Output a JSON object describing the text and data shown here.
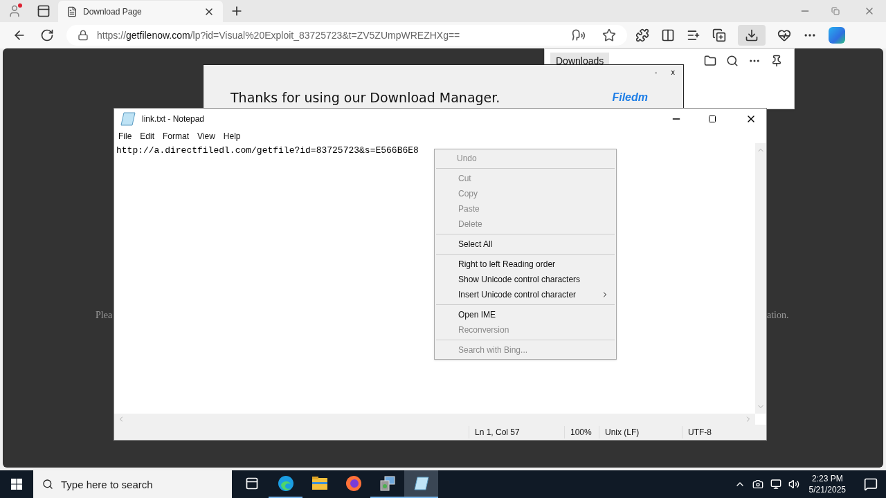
{
  "browser": {
    "tabs": [
      {
        "title": "Download Page",
        "selected": true
      }
    ],
    "address": {
      "scheme": "https://",
      "host": "getfilenow.com",
      "path": "/lp?id=Visual%20Exploit_83725723&t=ZV5ZUmpWREZHXg=="
    },
    "downloads_panel": {
      "title": "Downloads"
    },
    "page": {
      "text_left": "Plea",
      "text_right": "ation."
    },
    "dialog": {
      "minimize": "-",
      "close": "x",
      "message": "Thanks for using our Download Manager.",
      "logo": "Filedm"
    }
  },
  "notepad": {
    "title": "link.txt - Notepad",
    "menu": [
      "File",
      "Edit",
      "Format",
      "View",
      "Help"
    ],
    "content": "http://a.directfiledl.com/getfile?id=83725723&s=E566B6E8",
    "status_bar": [
      "Ln 1, Col 57",
      "100%",
      "Unix (LF)",
      "UTF-8"
    ]
  },
  "context_menu": {
    "groups": [
      [
        {
          "label": "Undo",
          "disabled": true,
          "submenu": false
        }
      ],
      [
        {
          "label": "Cut",
          "disabled": true,
          "submenu": false
        },
        {
          "label": "Copy",
          "disabled": true,
          "submenu": false
        },
        {
          "label": "Paste",
          "disabled": true,
          "submenu": false
        },
        {
          "label": "Delete",
          "disabled": true,
          "submenu": false
        }
      ],
      [
        {
          "label": "Select All",
          "disabled": false,
          "submenu": false
        }
      ],
      [
        {
          "label": "Right to left Reading order",
          "disabled": false,
          "submenu": false
        },
        {
          "label": "Show Unicode control characters",
          "disabled": false,
          "submenu": false
        },
        {
          "label": "Insert Unicode control character",
          "disabled": false,
          "submenu": true
        }
      ],
      [
        {
          "label": "Open IME",
          "disabled": false,
          "submenu": false
        },
        {
          "label": "Reconversion",
          "disabled": true,
          "submenu": false
        }
      ],
      [
        {
          "label": "Search with Bing...",
          "disabled": true,
          "submenu": false
        }
      ]
    ]
  },
  "taskbar": {
    "search": {
      "placeholder": "Type here to search"
    },
    "apps": [
      {
        "kind": "taskview",
        "running": false,
        "selected": false
      },
      {
        "kind": "edge",
        "running": true,
        "selected": false
      },
      {
        "kind": "explorer",
        "running": false,
        "selected": false
      },
      {
        "kind": "firefox",
        "running": false,
        "selected": false
      },
      {
        "kind": "installer",
        "running": true,
        "selected": false
      },
      {
        "kind": "notepad",
        "running": true,
        "selected": true
      }
    ],
    "time": "2:23 PM",
    "date": "5/21/2025"
  }
}
